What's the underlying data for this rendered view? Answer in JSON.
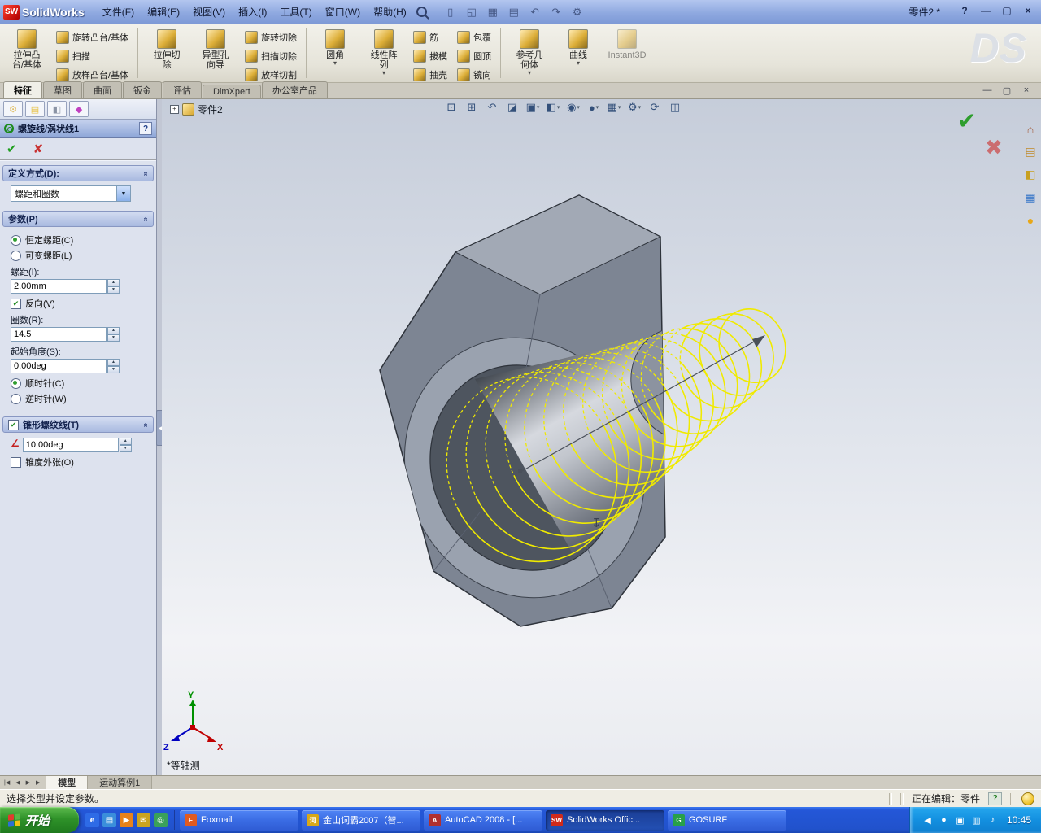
{
  "colors": {
    "helix": "#f0ea00",
    "confirm_ok": "#2e9e2e",
    "confirm_cancel": "#cc5555"
  },
  "titlebar": {
    "logo_text": "SW",
    "app_name": "SolidWorks",
    "menus": [
      "文件(F)",
      "编辑(E)",
      "视图(V)",
      "插入(I)",
      "工具(T)",
      "窗口(W)",
      "帮助(H)"
    ],
    "tool_icons": [
      "new",
      "open",
      "save",
      "print",
      "undo",
      "redo",
      "options"
    ],
    "document_title": "零件2 *",
    "controls": [
      "?",
      "—",
      "▢",
      "×"
    ]
  },
  "ribbon": {
    "watermark": "DS",
    "columns": [
      {
        "big": {
          "label_lines": [
            "拉伸凸",
            "台/基体"
          ],
          "name": "extruded-boss-base",
          "disabled": false,
          "arrow": false
        }
      },
      {
        "stack": [
          {
            "label": "旋转凸台/基体",
            "name": "revolved-boss-base"
          },
          {
            "label": "扫描",
            "name": "swept-boss-base"
          },
          {
            "label": "放样凸台/基体",
            "name": "lofted-boss-base"
          }
        ]
      },
      {
        "sep": true
      },
      {
        "big": {
          "label_lines": [
            "拉伸切",
            "除"
          ],
          "name": "extruded-cut",
          "disabled": false,
          "arrow": false
        }
      },
      {
        "big": {
          "label_lines": [
            "异型孔",
            "向导"
          ],
          "name": "hole-wizard",
          "disabled": false,
          "arrow": false
        }
      },
      {
        "stack": [
          {
            "label": "旋转切除",
            "name": "revolved-cut"
          },
          {
            "label": "扫描切除",
            "name": "swept-cut"
          },
          {
            "label": "放样切割",
            "name": "lofted-cut"
          }
        ]
      },
      {
        "sep": true
      },
      {
        "big": {
          "label_lines": [
            "圆角"
          ],
          "name": "fillet",
          "disabled": false,
          "arrow": true
        }
      },
      {
        "big": {
          "label_lines": [
            "线性阵",
            "列"
          ],
          "name": "linear-pattern",
          "disabled": false,
          "arrow": true
        }
      },
      {
        "stack": [
          {
            "label": "筋",
            "name": "rib"
          },
          {
            "label": "拔模",
            "name": "draft"
          },
          {
            "label": "抽壳",
            "name": "shell"
          }
        ]
      },
      {
        "stack": [
          {
            "label": "包覆",
            "name": "wrap"
          },
          {
            "label": "圆顶",
            "name": "dome"
          },
          {
            "label": "镜向",
            "name": "mirror"
          }
        ]
      },
      {
        "sep": true
      },
      {
        "big": {
          "label_lines": [
            "参考几",
            "何体"
          ],
          "name": "reference-geometry",
          "disabled": false,
          "arrow": true
        }
      },
      {
        "big": {
          "label_lines": [
            "曲线"
          ],
          "name": "curves",
          "disabled": false,
          "arrow": true
        }
      },
      {
        "big": {
          "label_lines": [
            "Instant3D"
          ],
          "name": "instant3d",
          "disabled": true,
          "arrow": false
        }
      }
    ]
  },
  "cm_tabs": [
    {
      "label": "特征",
      "active": true
    },
    {
      "label": "草图",
      "active": false
    },
    {
      "label": "曲面",
      "active": false
    },
    {
      "label": "钣金",
      "active": false
    },
    {
      "label": "评估",
      "active": false
    },
    {
      "label": "DimXpert",
      "active": false
    },
    {
      "label": "办公室产品",
      "active": false
    }
  ],
  "doc_controls": [
    "—",
    "▢",
    "×"
  ],
  "view_toolbar": [
    {
      "name": "zoom-to-fit",
      "arrow": false
    },
    {
      "name": "zoom-to-area",
      "arrow": false
    },
    {
      "name": "previous-view",
      "arrow": false
    },
    {
      "name": "section-view",
      "arrow": false
    },
    {
      "name": "view-orientation",
      "arrow": true
    },
    {
      "name": "display-style",
      "arrow": true
    },
    {
      "name": "hide-show-items",
      "arrow": true
    },
    {
      "name": "edit-appearance",
      "arrow": true
    },
    {
      "name": "apply-scene",
      "arrow": true
    },
    {
      "name": "view-settings",
      "arrow": true
    },
    {
      "name": "rotate-view",
      "arrow": false
    },
    {
      "name": "3d-drawing-view",
      "arrow": false
    }
  ],
  "pm": {
    "title": "螺旋线/涡状线1",
    "help": "?",
    "ok": "✔",
    "cancel": "✘",
    "def_header": "定义方式(D):",
    "def_value": "螺距和圈数",
    "param_header": "参数(P)",
    "constant_pitch": "恒定螺距(C)",
    "variable_pitch": "可变螺距(L)",
    "pitch_label": "螺距(I):",
    "pitch_value": "2.00mm",
    "reverse": "反向(V)",
    "rev_label": "圈数(R):",
    "rev_value": "14.5",
    "start_angle_label": "起始角度(S):",
    "start_angle_value": "0.00deg",
    "clockwise": "顺时针(C)",
    "counterclockwise": "逆时针(W)",
    "taper_header": "锥形螺纹线(T)",
    "taper_angle_value": "10.00deg",
    "taper_outward": "锥度外张(O)"
  },
  "viewport": {
    "feature_tree_root": "零件2",
    "view_orientation_label": "*等轴测",
    "triad": {
      "x": "X",
      "y": "Y",
      "z": "Z"
    },
    "confirm_ok": "✔",
    "confirm_cancel": "✖",
    "task_pane_icons": [
      "solidworks-resources",
      "design-library",
      "file-explorer",
      "view-palette",
      "appearances"
    ],
    "helix_revolutions": 14.5
  },
  "bottom_tabs": {
    "nav": [
      "|◀",
      "◀",
      "▶",
      "▶|"
    ],
    "tabs": [
      {
        "label": "模型",
        "active": true
      },
      {
        "label": "运动算例1",
        "active": false
      }
    ]
  },
  "statusbar": {
    "message": "选择类型并设定参数。",
    "editing_status": "正在编辑：零件",
    "tip_icon": "?"
  },
  "taskbar": {
    "start_label": "开始",
    "quick_launch": [
      "internet-explorer",
      "show-desktop",
      "media-player",
      "mail",
      "browser"
    ],
    "buttons": [
      {
        "label": "Foxmail",
        "icon": "foxmail",
        "active": false
      },
      {
        "label": "金山词霸2007（智...",
        "icon": "kingsoft-ciba",
        "active": false
      },
      {
        "label": "AutoCAD 2008 - [...",
        "icon": "autocad",
        "active": false
      },
      {
        "label": "SolidWorks Offic...",
        "icon": "solidworks",
        "active": true
      },
      {
        "label": "GOSURF",
        "icon": "gosurf",
        "active": false
      }
    ],
    "tray_icons": [
      "hide-icons",
      "messenger",
      "antivirus",
      "network",
      "volume"
    ],
    "clock": "10:45"
  }
}
